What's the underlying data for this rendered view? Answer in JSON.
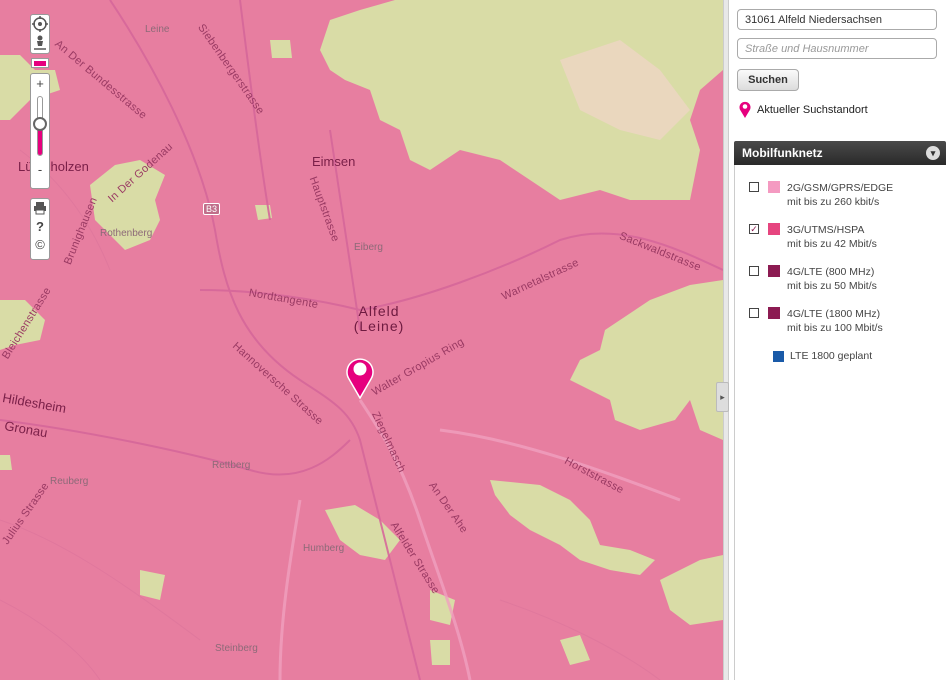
{
  "map": {
    "labels": {
      "an_der_bundesstrasse": "An Der Bundesstrasse",
      "siebenbergerstrasse": "Siebenbergerstrasse",
      "leine": "Leine",
      "eimsen": "Eimsen",
      "hauptstrasse": "Hauptstrasse",
      "luetzenholzen": "Lütenholzen",
      "in_der_godenau": "In Der Godenau",
      "brunighausen": "Brunighausen",
      "rothenberg": "Rothenberg",
      "b3": "B3",
      "eiberg": "Eiberg",
      "warnetalstrasse": "Warnetalstrasse",
      "sackwaldstrasse": "Sackwaldstrasse",
      "nordtangente": "Nordtangente",
      "alfeld": "Alfeld",
      "alfeld_sub": "(Leine)",
      "gropius_ring": "Walter Gropius Ring",
      "hannoversche_strasse": "Hannoversche Strasse",
      "ziegelmasch": "Ziegelmasch",
      "hildesheim": "Hildesheim",
      "gronau": "Gronau",
      "bleichenstrasse": "Bleichenstrasse",
      "horststrasse": "Horststrasse",
      "rettberg": "Rettberg",
      "reuberg": "Reuberg",
      "an_der_ahe": "An Der Ahe",
      "julius_strasse": "Julius Strasse",
      "alfelder_strasse": "Alfelder Strasse",
      "humberg": "Humberg",
      "steinberg": "Steinberg"
    }
  },
  "controls": {
    "pan_icon": "pan-icon",
    "streetview_icon": "person-icon",
    "layer_icon": "layer-switch-icon",
    "zoom_in": "+",
    "zoom_out": "-",
    "zoom_level": 0.55,
    "print_icon": "printer-icon",
    "help": "?",
    "copyright": "©"
  },
  "search": {
    "location_value": "31061 Alfeld Niedersachsen",
    "street_placeholder": "Straße und Hausnummer",
    "button_label": "Suchen",
    "current_location_label": "Aktueller Suchstandort"
  },
  "panel": {
    "title": "Mobilfunknetz",
    "layers": [
      {
        "name": "2G/GSM/GPRS/EDGE",
        "speed": "mit bis zu 260 kbit/s",
        "checked": false,
        "color": "#f49ac1"
      },
      {
        "name": "3G/UTMS/HSPA",
        "speed": "mit bis zu 42 Mbit/s",
        "checked": true,
        "color": "#e6457f"
      },
      {
        "name": "4G/LTE (800 MHz)",
        "speed": "mit bis zu 50 Mbit/s",
        "checked": false,
        "color": "#8c1b52"
      },
      {
        "name": "4G/LTE (1800 MHz)",
        "speed": "mit bis zu 100 Mbit/s",
        "checked": false,
        "color": "#8c1b52"
      }
    ],
    "planned_label": "LTE 1800 geplant",
    "planned_color": "#1a5aa8",
    "check_mark": "✓"
  },
  "colors": {
    "coverage": "#e77ea0",
    "no_coverage": "#d9dca6",
    "accent": "#e6007e"
  }
}
